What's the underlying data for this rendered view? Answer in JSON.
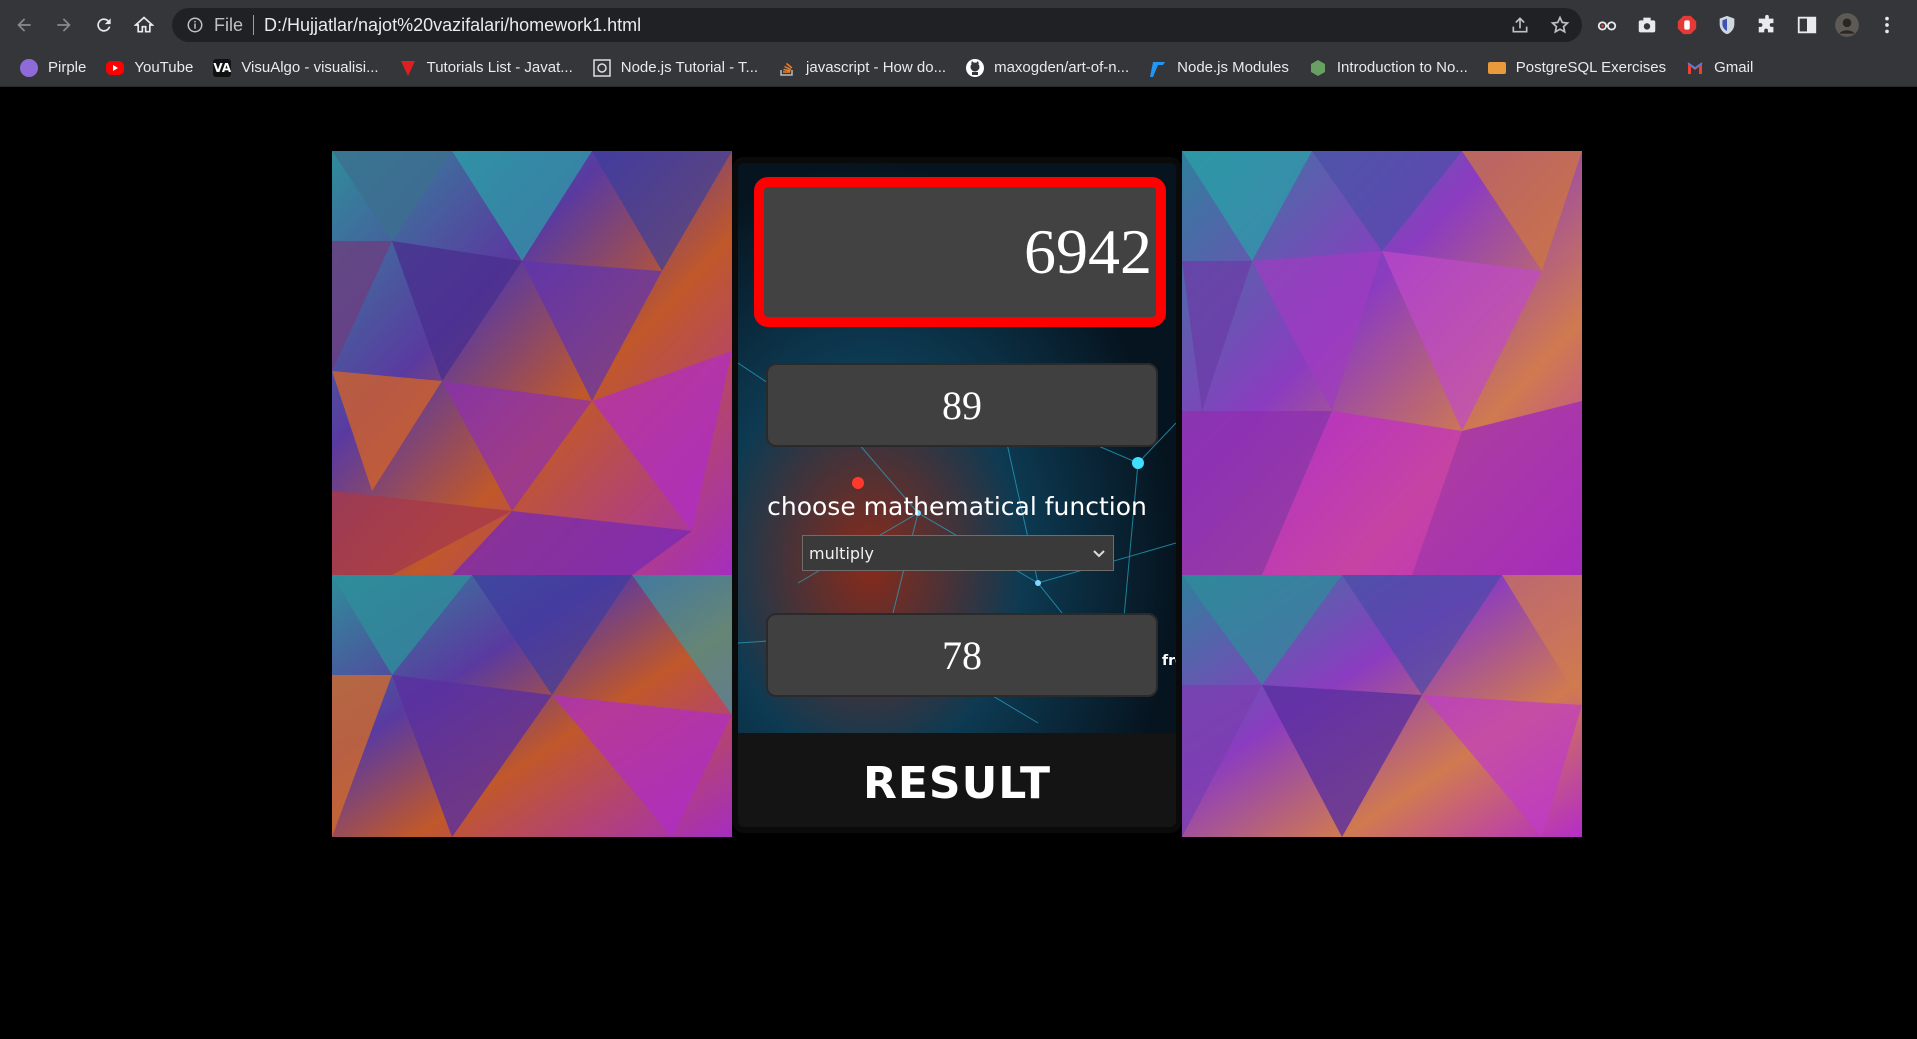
{
  "browser": {
    "back_icon": "arrow-left-icon",
    "forward_icon": "arrow-right-icon",
    "reload_icon": "reload-icon",
    "home_icon": "home-icon",
    "address": {
      "scheme_label": "File",
      "url": "D:/Hujjatlar/najot%20vazifalari/homework1.html"
    },
    "bookmarks": [
      {
        "label": "Pirple",
        "icon": "pirple-icon",
        "color": "#8e6bd8"
      },
      {
        "label": "YouTube",
        "icon": "youtube-icon",
        "color": "#ff0000"
      },
      {
        "label": "VisuAlgo - visualisi...",
        "icon": "visualgo-icon",
        "color": "#ffffff"
      },
      {
        "label": "Tutorials List - Javat...",
        "icon": "javatpoint-icon",
        "color": "#e02020"
      },
      {
        "label": "Node.js Tutorial - T...",
        "icon": "tutorialspoint-icon",
        "color": "#dddddd"
      },
      {
        "label": "javascript - How do...",
        "icon": "stackoverflow-icon",
        "color": "#f48024"
      },
      {
        "label": "maxogden/art-of-n...",
        "icon": "github-icon",
        "color": "#ffffff"
      },
      {
        "label": "Node.js Modules",
        "icon": "w3schools-icon",
        "color": "#2196f3"
      },
      {
        "label": "Introduction to No...",
        "icon": "nodejs-icon",
        "color": "#68a063"
      },
      {
        "label": "PostgreSQL Exercises",
        "icon": "pgexercises-icon",
        "color": "#e89a3c"
      },
      {
        "label": "Gmail",
        "icon": "gmail-icon",
        "color": "#ea4335"
      }
    ]
  },
  "calculator": {
    "display_value": "6942",
    "first_number": "89",
    "function_label": "choose mathematical function",
    "selected_function": "multiply",
    "second_number": "78",
    "side_text": "fre",
    "result_label": "RESULT"
  },
  "colors": {
    "display_border": "#ff0000",
    "panel_background": "#424242"
  }
}
